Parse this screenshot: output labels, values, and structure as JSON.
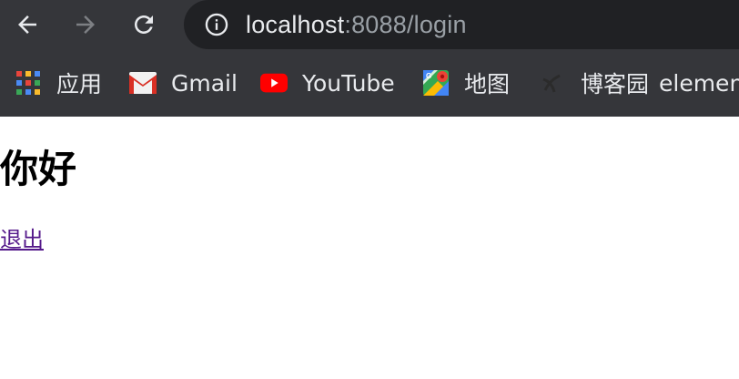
{
  "browser": {
    "nav": {
      "back": "arrow-left-icon",
      "forward": "arrow-right-icon",
      "reload": "reload-icon"
    },
    "address": {
      "host": "localhost",
      "rest": ":8088/login"
    },
    "bookmarks": [
      {
        "label": "应用",
        "icon": "apps-grid-icon"
      },
      {
        "label": "Gmail",
        "icon": "gmail-icon"
      },
      {
        "label": "YouTube",
        "icon": "youtube-icon"
      },
      {
        "label": "地图",
        "icon": "maps-icon"
      },
      {
        "label": "博客园",
        "icon": "cnblogs-icon"
      },
      {
        "label": "element",
        "icon": ""
      }
    ]
  },
  "page": {
    "greeting": "你好",
    "logout_link": "退出"
  },
  "colors": {
    "toolbar": "#35363a",
    "omnibox": "#202124",
    "visited_link": "#551a8b"
  }
}
